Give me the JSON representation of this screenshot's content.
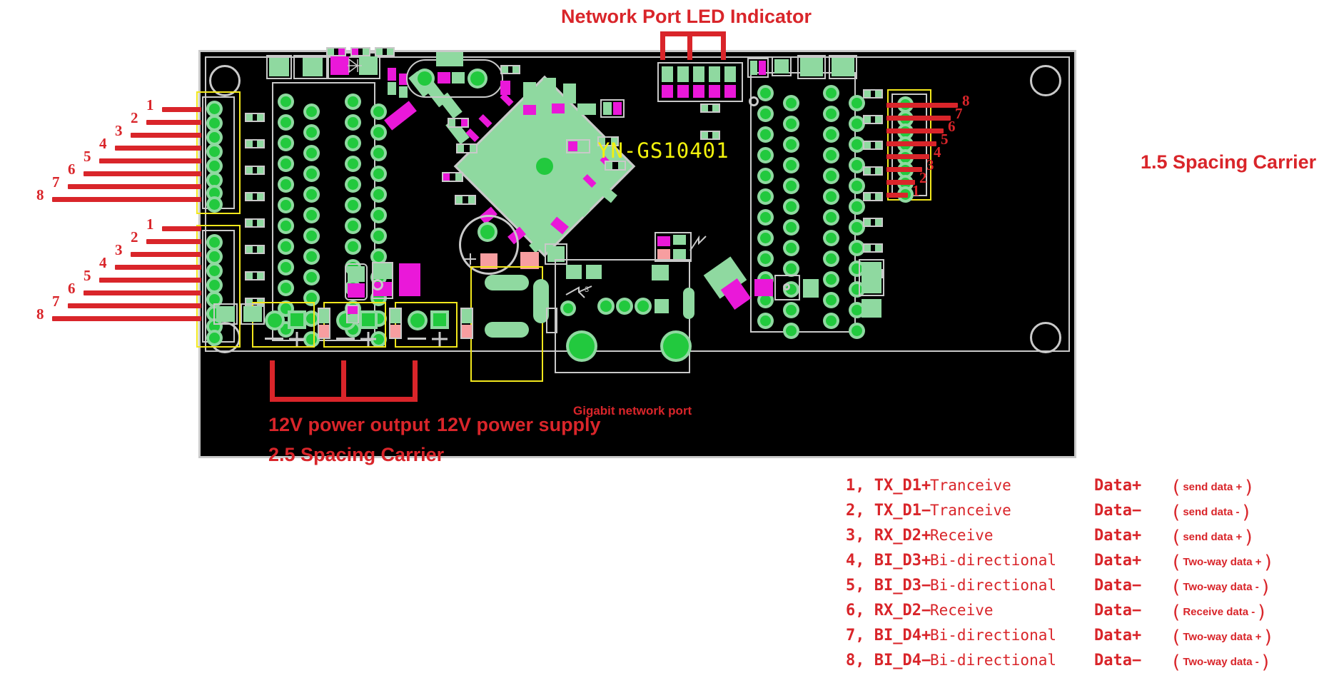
{
  "board": {
    "silkscreen_label": "YN-GS10401",
    "colors": {
      "annotation_red": "#d9252a",
      "silk_label_yellow": "#f2f20c",
      "pad_green": "#22c93e",
      "copper_light_green": "#8fd9a0",
      "magenta": "#ea18d9",
      "pink": "#f79ea0",
      "outline_gray": "#c9c9c9",
      "highlight_yellow": "#f2e71c",
      "substrate": "#000000"
    },
    "power_terminal_markings": [
      "−",
      "+"
    ]
  },
  "annotations": {
    "top_title": "Network Port LED Indicator",
    "right_carrier": "1.5 Spacing Carrier",
    "power_output": "12V power output",
    "power_output_carrier": "2.5 Spacing Carrier",
    "power_supply": "12V power supply",
    "gigabit_port": "Gigabit network port"
  },
  "left_connector_top": {
    "pins": [
      "1",
      "2",
      "3",
      "4",
      "5",
      "6",
      "7",
      "8"
    ]
  },
  "left_connector_bottom": {
    "pins": [
      "1",
      "2",
      "3",
      "4",
      "5",
      "6",
      "7",
      "8"
    ]
  },
  "right_connector": {
    "pins": [
      "8",
      "7",
      "6",
      "5",
      "4",
      "3",
      "2",
      "1"
    ]
  },
  "pinout_table": {
    "rows": [
      {
        "index": "1, TX_D1+",
        "function": "Tranceive",
        "direction": "Data+",
        "paren": "send data +"
      },
      {
        "index": "2, TX_D1−",
        "function": "Tranceive",
        "direction": "Data−",
        "paren": "send data -"
      },
      {
        "index": "3, RX_D2+",
        "function": "Receive",
        "direction": "Data+",
        "paren": "send data +"
      },
      {
        "index": "4, BI_D3+",
        "function": "Bi-directional",
        "direction": "Data+",
        "paren": "Two-way data +"
      },
      {
        "index": "5, BI_D3−",
        "function": "Bi-directional",
        "direction": "Data−",
        "paren": "Two-way data -"
      },
      {
        "index": "6, RX_D2−",
        "function": "Receive",
        "direction": "Data−",
        "paren": "Receive data -"
      },
      {
        "index": "7, BI_D4+",
        "function": "Bi-directional",
        "direction": "Data+",
        "paren": "Two-way data +"
      },
      {
        "index": "8, BI_D4−",
        "function": "Bi-directional",
        "direction": "Data−",
        "paren": "Two-way data -"
      }
    ]
  }
}
